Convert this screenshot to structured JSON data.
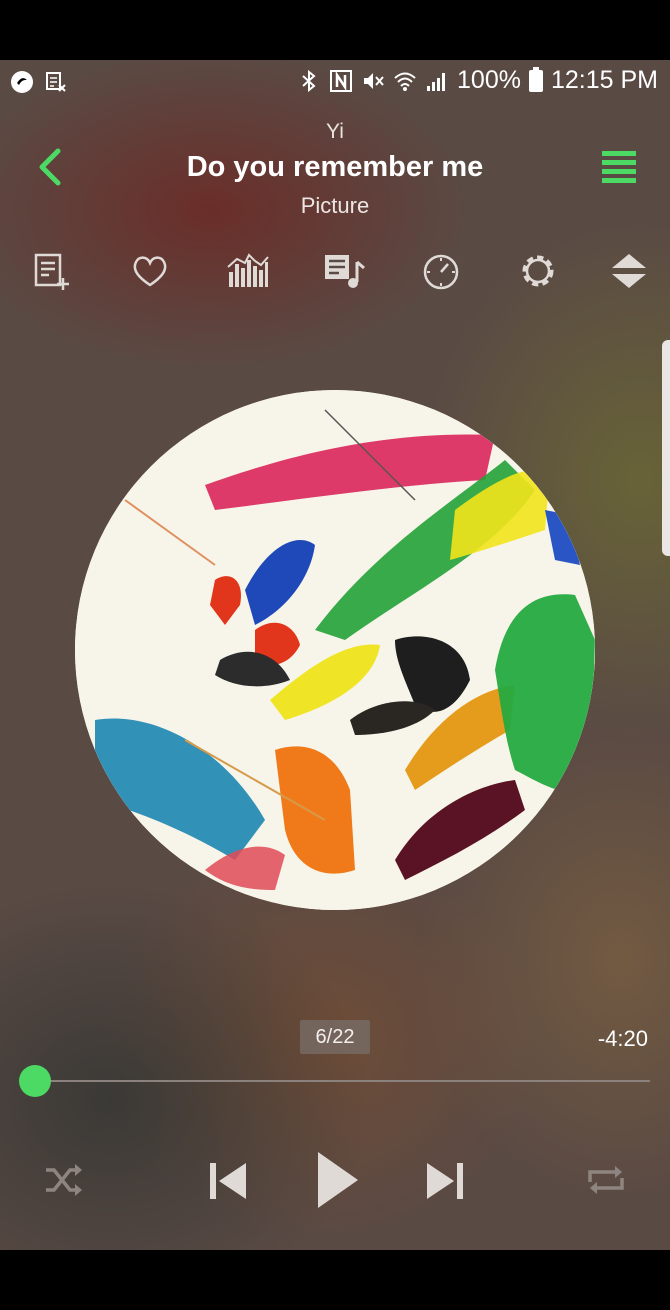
{
  "status_bar": {
    "battery_text": "100%",
    "time": "12:15 PM",
    "icons": [
      "app-notification-icon",
      "screenshot-icon",
      "bluetooth-icon",
      "nfc-icon",
      "mute-icon",
      "wifi-icon",
      "signal-icon",
      "battery-icon"
    ]
  },
  "now_playing": {
    "artist": "Yi",
    "title": "Do you remember me",
    "album": "Picture"
  },
  "toolbar": {
    "icons": [
      "add-to-playlist-icon",
      "favorite-heart-icon",
      "equalizer-icon",
      "queue-icon",
      "sleep-timer-icon",
      "settings-icon",
      "expand-collapse-icon"
    ]
  },
  "playback": {
    "track_position": "6/22",
    "time_remaining": "-4:20",
    "progress": 0.0
  },
  "controls": {
    "icons": [
      "shuffle-icon",
      "previous-icon",
      "play-icon",
      "next-icon",
      "repeat-icon"
    ]
  },
  "colors": {
    "accent": "#4cd964",
    "background": "#5a4a44",
    "control_tint": "#e0dad7",
    "disabled_tint": "#8f8580"
  }
}
